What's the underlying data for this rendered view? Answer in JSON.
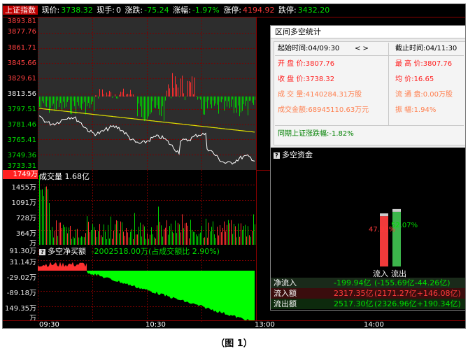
{
  "header": {
    "index_name": "上证指数",
    "price_label": "现价:",
    "price_value": "3738.32",
    "volnow_label": "现手:",
    "volnow_value": "0",
    "change_label": "涨跌:",
    "change_value": "-75.24",
    "pct_label": "涨幅:",
    "pct_value": "-1.97%",
    "limitup_label": "涨停:",
    "limitup_value": "4194.92",
    "limitdown_label": "跌停:",
    "limitdown_value": "3432.20"
  },
  "price_axis": [
    "3893.81",
    "3877.76",
    "3861.71",
    "3845.66",
    "3829.61",
    "3813.56",
    "3797.51",
    "3781.46",
    "3765.41",
    "3749.36",
    "3733.31"
  ],
  "volume_pane": {
    "title": "成交量 1.68亿",
    "axis_top": "1749万",
    "axis": [
      "1455万",
      "1091万",
      "728万",
      "364万",
      "万"
    ]
  },
  "flow_pane": {
    "title": "多空净买额",
    "value": "-2002518.00万(占成交额比 2.90%)",
    "axis": [
      "91.30万",
      "31.14万",
      "-29.02万",
      "-89.18万",
      "149.35万",
      "万"
    ]
  },
  "time_axis": [
    "09:30",
    "10:30",
    "13:00",
    "14:00"
  ],
  "popup": {
    "title": "区间多空统计",
    "start_label": "起始时间:",
    "start_value": "04/09:30",
    "nav": "< >",
    "end_label": "截止时间:",
    "end_value": "04/11:30",
    "open_label": "开 盘 价:",
    "open_value": "3807.76",
    "high_label": "最 高 价:",
    "high_value": "3807.76",
    "close_label": "收 盘 价:",
    "close_value": "3738.32",
    "avg_label": "均    价:",
    "avg_value": "16.65",
    "deal_vol_label": "成 交 量:",
    "deal_vol_value": "4140284.31万股",
    "float_label": "流 通 盘:",
    "float_value": "0.00万股",
    "deal_amt_label": "成交金额:",
    "deal_amt_value": "68945110.63万元",
    "amp_label": "振    幅:",
    "amp_value": "1.94%",
    "same_period_label": "同期上证涨跌幅:",
    "same_period_value": "-1.82%",
    "funds_title": "多空资金",
    "bar_in_pct": "47.93%",
    "bar_out_pct": "52.07%",
    "bar_in_label": "流入",
    "bar_out_label": "流出",
    "net_label": "净流入",
    "net_value": "-199.94亿",
    "net_detail": "(-155.69亿-44.26亿)",
    "in_label": "流入额",
    "in_value": "2317.35亿",
    "in_detail": "(2171.27亿+146.08亿)",
    "out_label": "流出额",
    "out_value": "2517.30亿",
    "out_detail": "(2326.96亿+190.34亿)"
  },
  "caption": "（图 1）",
  "colors": {
    "up": "#ff3030",
    "down": "#00d000",
    "avg_line": "#e0e000",
    "price_line": "#ffffff",
    "flow_fill": "#00ff00"
  }
}
